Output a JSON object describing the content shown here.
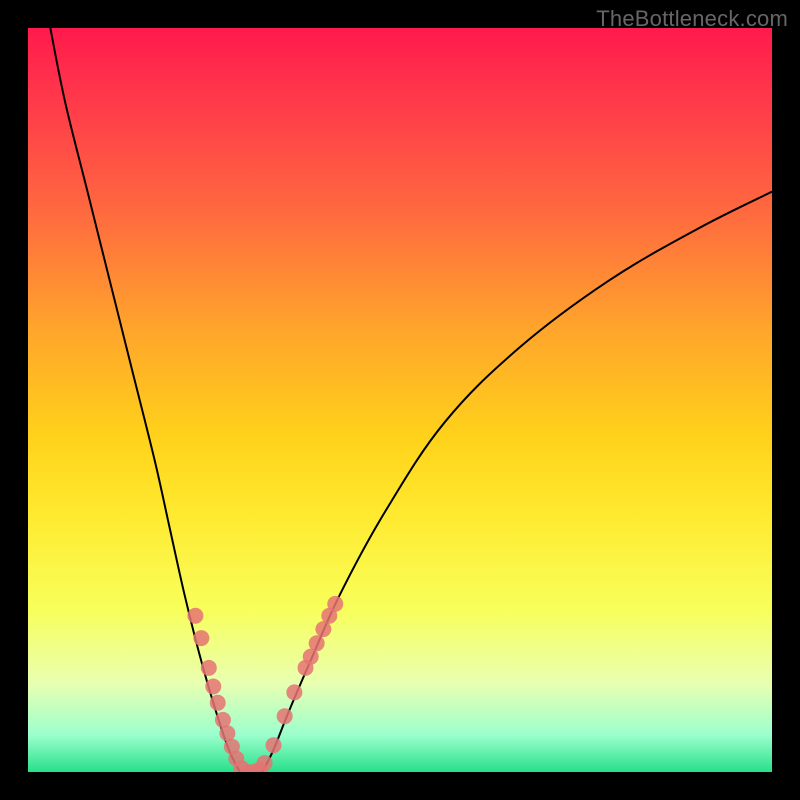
{
  "watermark": "TheBottleneck.com",
  "chart_data": {
    "type": "line",
    "title": "",
    "xlabel": "",
    "ylabel": "",
    "xlim": [
      0,
      100
    ],
    "ylim": [
      0,
      100
    ],
    "grid": false,
    "legend": false,
    "background_gradient": {
      "top": "#ff1a4d",
      "mid": "#ffd21a",
      "bottom": "#27e08a"
    },
    "series": [
      {
        "name": "left-curve",
        "x": [
          3,
          5,
          8,
          11,
          14,
          17,
          19,
          21,
          23,
          25,
          27,
          28.5
        ],
        "y": [
          100,
          90,
          78,
          66,
          54,
          42,
          33,
          24,
          16,
          9,
          3,
          0
        ]
      },
      {
        "name": "right-curve",
        "x": [
          31.5,
          33,
          35,
          38,
          42,
          48,
          56,
          66,
          78,
          90,
          100
        ],
        "y": [
          0,
          3,
          8,
          15,
          24,
          35,
          47,
          57,
          66,
          73,
          78
        ]
      }
    ],
    "bottom_segment": {
      "x0": 28.5,
      "x1": 31.5,
      "y": 0
    },
    "dots": {
      "color": "#e57373",
      "radius_px": 8,
      "points": [
        {
          "x": 22.5,
          "y": 21
        },
        {
          "x": 23.3,
          "y": 18
        },
        {
          "x": 24.3,
          "y": 14
        },
        {
          "x": 24.9,
          "y": 11.5
        },
        {
          "x": 25.5,
          "y": 9.3
        },
        {
          "x": 26.2,
          "y": 7
        },
        {
          "x": 26.8,
          "y": 5.2
        },
        {
          "x": 27.4,
          "y": 3.4
        },
        {
          "x": 28.0,
          "y": 1.8
        },
        {
          "x": 28.7,
          "y": 0.5
        },
        {
          "x": 29.5,
          "y": 0
        },
        {
          "x": 30.3,
          "y": 0
        },
        {
          "x": 31.1,
          "y": 0.3
        },
        {
          "x": 31.8,
          "y": 1.2
        },
        {
          "x": 33.0,
          "y": 3.6
        },
        {
          "x": 34.5,
          "y": 7.5
        },
        {
          "x": 35.8,
          "y": 10.7
        },
        {
          "x": 37.3,
          "y": 14.0
        },
        {
          "x": 38.0,
          "y": 15.5
        },
        {
          "x": 38.8,
          "y": 17.3
        },
        {
          "x": 39.7,
          "y": 19.2
        },
        {
          "x": 40.5,
          "y": 21.0
        },
        {
          "x": 41.3,
          "y": 22.6
        }
      ]
    }
  }
}
